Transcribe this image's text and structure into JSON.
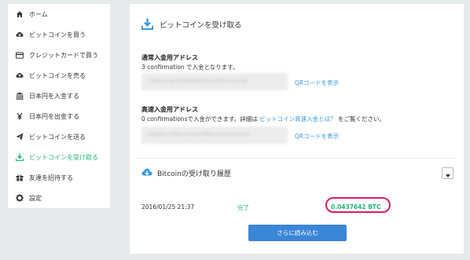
{
  "sidebar": {
    "items": [
      {
        "label": "ホーム",
        "icon": "home-icon"
      },
      {
        "label": "ビットコインを買う",
        "icon": "cloud-download-icon"
      },
      {
        "label": "クレジットカードで買う",
        "icon": "credit-card-icon"
      },
      {
        "label": "ビットコインを売る",
        "icon": "cloud-upload-icon"
      },
      {
        "label": "日本円を入金する",
        "icon": "bank-icon"
      },
      {
        "label": "日本円を出金する",
        "icon": "yen-icon"
      },
      {
        "label": "ビットコインを送る",
        "icon": "paper-plane-icon"
      },
      {
        "label": "ビットコインを受け取る",
        "icon": "download-icon",
        "active": true
      },
      {
        "label": "友達を招待する",
        "icon": "gift-icon"
      },
      {
        "label": "設定",
        "icon": "gear-icon"
      }
    ]
  },
  "main": {
    "title": "ビットコインを受け取る",
    "normal": {
      "title": "通常入金用アドレス",
      "sub": "3 confirmation で入金となります。",
      "address": "1KxNnyPqzT8mWq4gbS3fLvJd2RrXcUaYeZ",
      "qr_link": "QRコードを表示"
    },
    "fast": {
      "title": "高速入金用アドレス",
      "sub_prefix": "0 confirmationsで入金ができます。詳細は ",
      "sub_link": "ビットコイン高速入金とは？",
      "sub_suffix": " をご覧ください。",
      "address": "3MpWh2YjNqkLs7dVaT9fRbUcXe4GzHoQn1",
      "qr_link": "QRコードを表示"
    },
    "history": {
      "title": "Bitcoinの受け取り履歴",
      "rows": [
        {
          "date": "2016/01/25 21:37",
          "status": "完了",
          "amount": "0.0437642 BTC"
        }
      ],
      "load_more": "さらに読み込む"
    }
  },
  "colors": {
    "accent_green": "#22b573",
    "link_blue": "#3a9ad9",
    "button_blue": "#3a86d6",
    "highlight": "#d81b6a",
    "background": "#e6eaea"
  }
}
